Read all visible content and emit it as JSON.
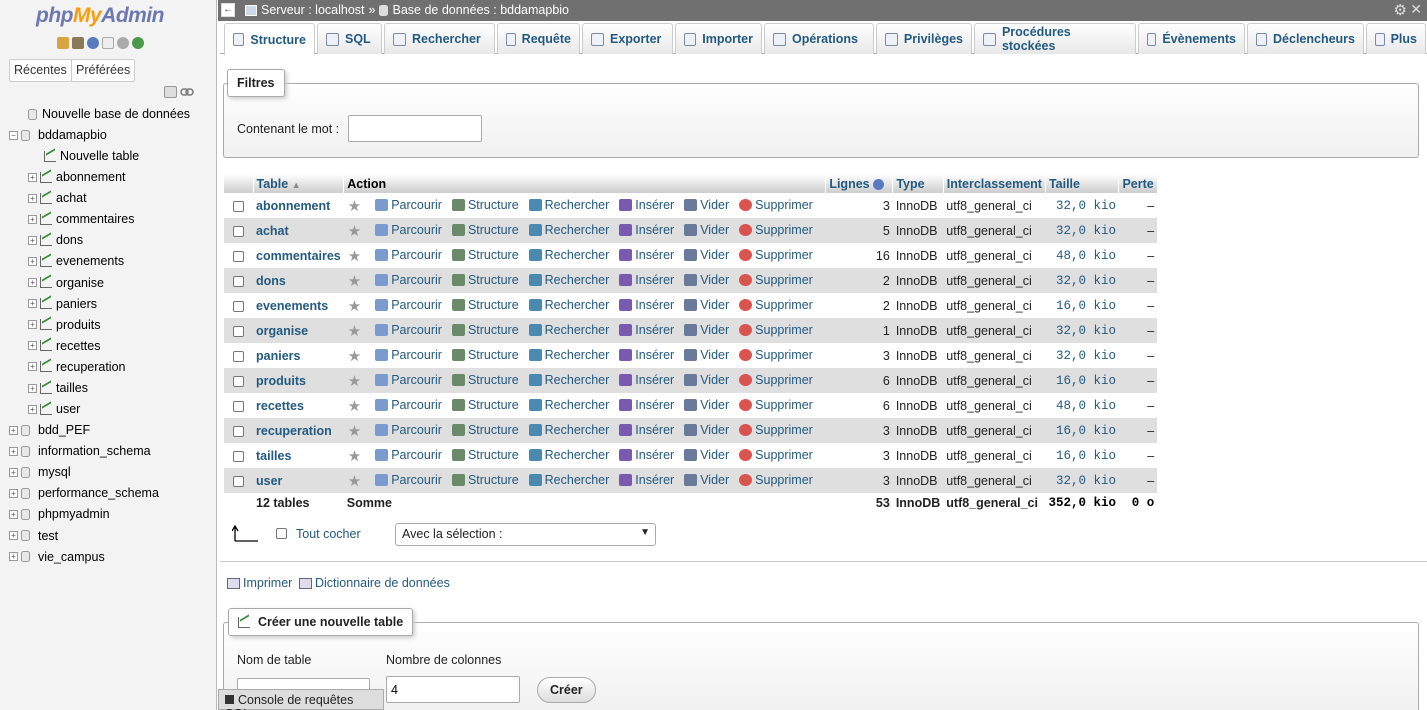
{
  "logo": {
    "php": "php",
    "my": "My",
    "admin": "Admin"
  },
  "sidebar": {
    "tabs": [
      "Récentes",
      "Préférées"
    ],
    "new_db": "Nouvelle base de données",
    "current_db": "bddamapbio",
    "new_table": "Nouvelle table",
    "tables": [
      "abonnement",
      "achat",
      "commentaires",
      "dons",
      "evenements",
      "organise",
      "paniers",
      "produits",
      "recettes",
      "recuperation",
      "tailles",
      "user"
    ],
    "other_dbs": [
      "bdd_PEF",
      "information_schema",
      "mysql",
      "performance_schema",
      "phpmyadmin",
      "test",
      "vie_campus"
    ]
  },
  "topbar": {
    "server": "Serveur : localhost",
    "sep": "»",
    "database": "Base de données : bddamapbio"
  },
  "tabs": [
    {
      "label": "Structure",
      "icon": "structure-icon"
    },
    {
      "label": "SQL",
      "icon": "sql-icon"
    },
    {
      "label": "Rechercher",
      "icon": "search-icon"
    },
    {
      "label": "Requête",
      "icon": "query-icon"
    },
    {
      "label": "Exporter",
      "icon": "export-icon"
    },
    {
      "label": "Importer",
      "icon": "import-icon"
    },
    {
      "label": "Opérations",
      "icon": "operations-icon"
    },
    {
      "label": "Privilèges",
      "icon": "privileges-icon"
    },
    {
      "label": "Procédures stockées",
      "icon": "routines-icon"
    },
    {
      "label": "Évènements",
      "icon": "events-icon"
    },
    {
      "label": "Déclencheurs",
      "icon": "triggers-icon"
    },
    {
      "label": "Plus",
      "icon": "more-icon"
    }
  ],
  "filters": {
    "legend": "Filtres",
    "label": "Contenant le mot :",
    "value": ""
  },
  "table_headers": {
    "table": "Table",
    "action": "Action",
    "rows": "Lignes",
    "type": "Type",
    "collation": "Interclassement",
    "size": "Taille",
    "overhead": "Perte"
  },
  "actions": {
    "browse": "Parcourir",
    "structure": "Structure",
    "search": "Rechercher",
    "insert": "Insérer",
    "empty": "Vider",
    "drop": "Supprimer"
  },
  "rows": [
    {
      "name": "abonnement",
      "rows": "3",
      "type": "InnoDB",
      "collation": "utf8_general_ci",
      "size": "32,0 kio",
      "overhead": "–"
    },
    {
      "name": "achat",
      "rows": "5",
      "type": "InnoDB",
      "collation": "utf8_general_ci",
      "size": "32,0 kio",
      "overhead": "–"
    },
    {
      "name": "commentaires",
      "rows": "16",
      "type": "InnoDB",
      "collation": "utf8_general_ci",
      "size": "48,0 kio",
      "overhead": "–"
    },
    {
      "name": "dons",
      "rows": "2",
      "type": "InnoDB",
      "collation": "utf8_general_ci",
      "size": "32,0 kio",
      "overhead": "–"
    },
    {
      "name": "evenements",
      "rows": "2",
      "type": "InnoDB",
      "collation": "utf8_general_ci",
      "size": "16,0 kio",
      "overhead": "–"
    },
    {
      "name": "organise",
      "rows": "1",
      "type": "InnoDB",
      "collation": "utf8_general_ci",
      "size": "32,0 kio",
      "overhead": "–"
    },
    {
      "name": "paniers",
      "rows": "3",
      "type": "InnoDB",
      "collation": "utf8_general_ci",
      "size": "32,0 kio",
      "overhead": "–"
    },
    {
      "name": "produits",
      "rows": "6",
      "type": "InnoDB",
      "collation": "utf8_general_ci",
      "size": "16,0 kio",
      "overhead": "–"
    },
    {
      "name": "recettes",
      "rows": "6",
      "type": "InnoDB",
      "collation": "utf8_general_ci",
      "size": "48,0 kio",
      "overhead": "–"
    },
    {
      "name": "recuperation",
      "rows": "3",
      "type": "InnoDB",
      "collation": "utf8_general_ci",
      "size": "16,0 kio",
      "overhead": "–"
    },
    {
      "name": "tailles",
      "rows": "3",
      "type": "InnoDB",
      "collation": "utf8_general_ci",
      "size": "16,0 kio",
      "overhead": "–"
    },
    {
      "name": "user",
      "rows": "3",
      "type": "InnoDB",
      "collation": "utf8_general_ci",
      "size": "32,0 kio",
      "overhead": "–"
    }
  ],
  "footer": {
    "count": "12 tables",
    "sum": "Somme",
    "rows": "53",
    "type": "InnoDB",
    "collation": "utf8_general_ci",
    "size": "352,0 kio",
    "overhead": "0 o"
  },
  "bulk": {
    "check_all": "Tout cocher",
    "with_selected": "Avec la sélection :"
  },
  "links": {
    "print": "Imprimer",
    "dictionary": "Dictionnaire de données"
  },
  "create": {
    "legend": "Créer une nouvelle table",
    "name_label": "Nom de table",
    "cols_label": "Nombre de colonnes",
    "cols_value": "4",
    "button": "Créer"
  },
  "console": "Console de requêtes SQL"
}
